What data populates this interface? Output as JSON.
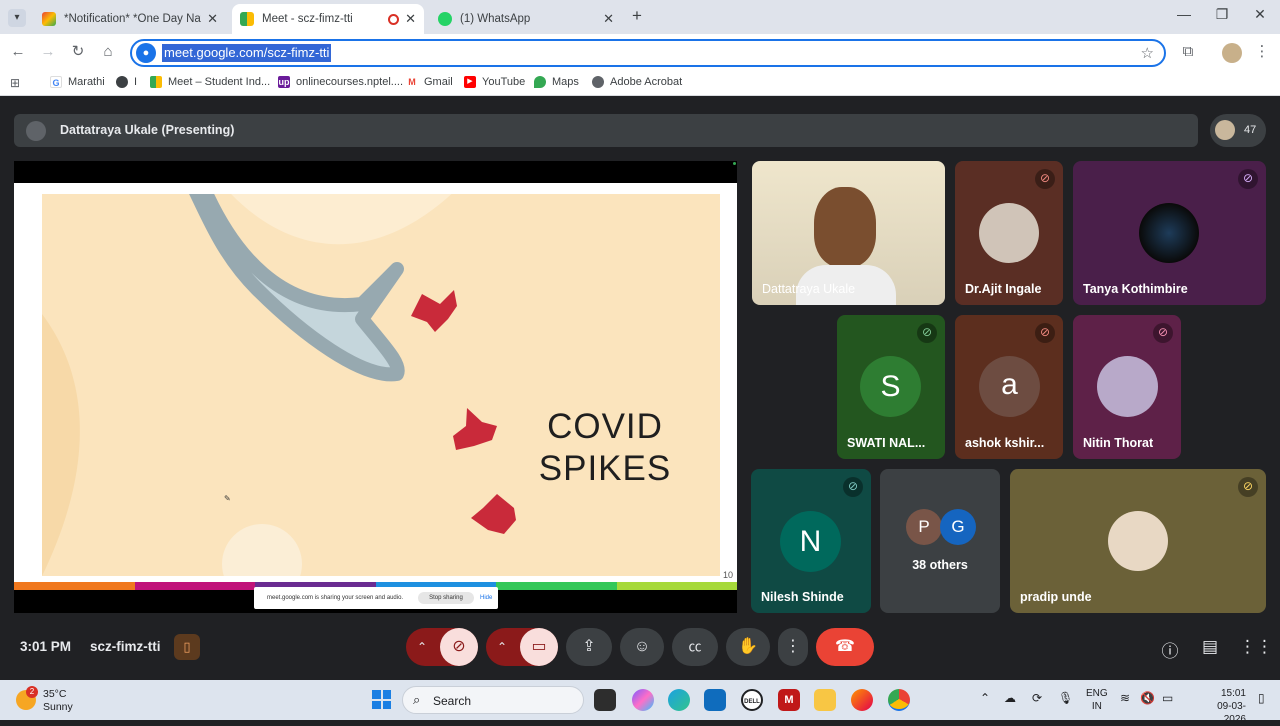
{
  "browser": {
    "tabs": [
      {
        "title": "*Notification* *One Day Nation",
        "icon": "gmail-icon",
        "active": false
      },
      {
        "title": "Meet - scz-fimz-tti",
        "icon": "meet-icon",
        "active": true
      },
      {
        "title": "(1) WhatsApp",
        "icon": "whatsapp-icon",
        "active": false
      }
    ],
    "new_tab": "+",
    "url": "meet.google.com/scz-fimz-tti",
    "bookmarks": [
      "Marathi",
      "I",
      "Meet – Student Ind...",
      "onlinecourses.nptel....",
      "Gmail",
      "YouTube",
      "Maps",
      "Adobe Acrobat"
    ]
  },
  "meet": {
    "presenter_label": "Dattatraya Ukale (Presenting)",
    "participant_count": "47",
    "slide": {
      "title_line1": "COVID",
      "title_line2": "SPIKES",
      "page_number": "10"
    },
    "share_notice": {
      "text": "meet.google.com is sharing your screen and audio.",
      "stop": "Stop sharing",
      "hide": "Hide"
    },
    "participants": [
      {
        "name": "Dattatraya Ukale",
        "muted": false
      },
      {
        "name": "Dr.Ajit Ingale",
        "muted": true
      },
      {
        "name": "Tanya Kothimbire",
        "muted": true
      },
      {
        "name": "SWATI NAL...",
        "initial": "S",
        "muted": true
      },
      {
        "name": "ashok kshir...",
        "initial": "a",
        "muted": true
      },
      {
        "name": "Nitin Thorat",
        "muted": true
      },
      {
        "name": "Nilesh Shinde",
        "initial": "N",
        "muted": true
      },
      {
        "name": "38 others",
        "initials": [
          "P",
          "G"
        ]
      },
      {
        "name": "pradip unde",
        "muted": true
      }
    ],
    "time": "3:01 PM",
    "meeting_code": "scz-fimz-tti",
    "colors": {
      "accent": "#1a73e8",
      "end_call": "#ea4335",
      "background": "#202124"
    }
  },
  "taskbar": {
    "weather_temp": "35°C",
    "weather_desc": "Sunny",
    "notification_badge": "2",
    "search_label": "Search",
    "lang_line1": "ENG",
    "lang_line2": "IN",
    "time": "15:01",
    "date": "09-03-2026"
  }
}
